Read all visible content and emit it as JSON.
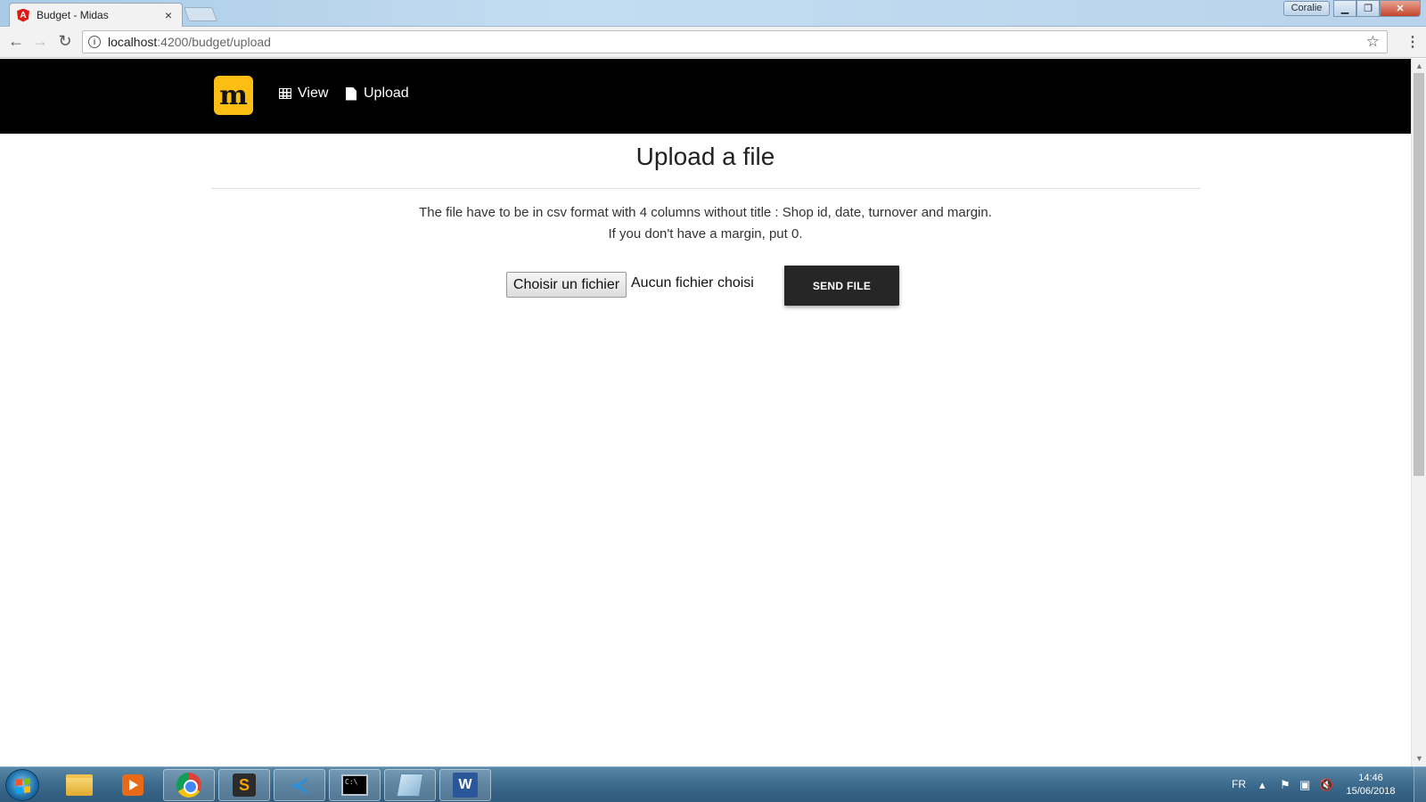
{
  "browser": {
    "tab_title": "Budget - Midas",
    "tab_close": "×",
    "profile_name": "Coralie",
    "url_host": "localhost",
    "url_rest": ":4200/budget/upload"
  },
  "app": {
    "logo_letter": "m",
    "brand_color": "#fdbe14",
    "nav": {
      "view_label": "View",
      "upload_label": "Upload"
    }
  },
  "page": {
    "title": "Upload a file",
    "instruction_line1": "The file have to be in csv format with 4 columns without title : Shop id, date, turnover and margin.",
    "instruction_line2": "If you don't have a margin, put 0.",
    "file_button_label": "Choisir un fichier",
    "file_status": "Aucun fichier choisi",
    "send_button_label": "SEND FILE"
  },
  "taskbar": {
    "apps": [
      "file-explorer",
      "media-player",
      "chrome",
      "sublime-text",
      "vscode",
      "command-prompt",
      "notepad",
      "word"
    ],
    "active_app": "chrome",
    "language": "FR",
    "time": "14:46",
    "date": "15/06/2018"
  }
}
